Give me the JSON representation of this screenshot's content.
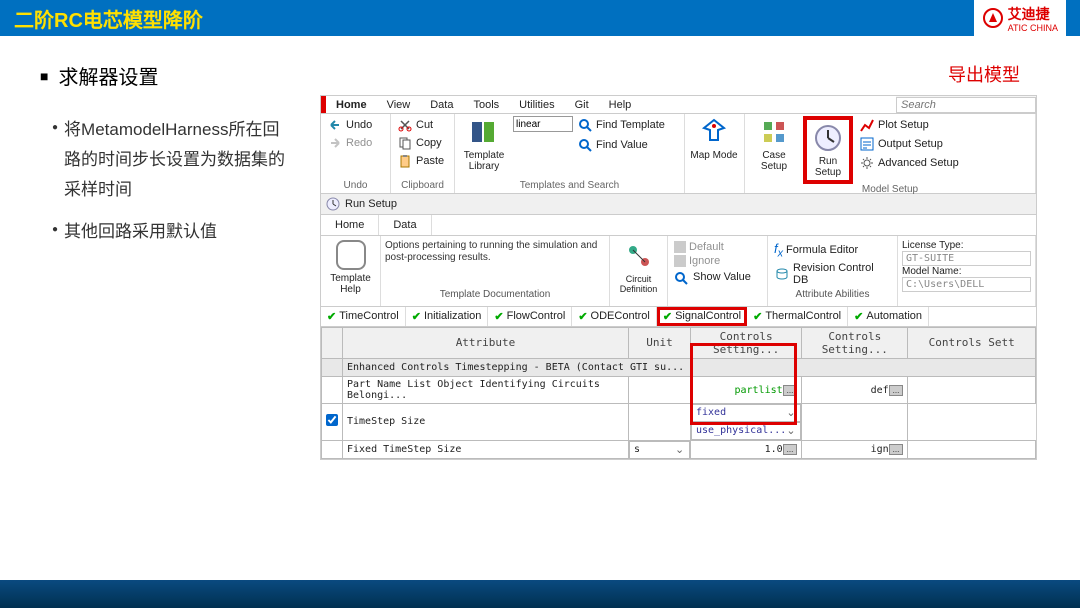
{
  "header": {
    "title": "二阶RC电芯模型降阶",
    "logo1": "艾迪捷",
    "logo2": "ATIC CHINA"
  },
  "left": {
    "section": "求解器设置",
    "export": "导出模型",
    "bullets": [
      "将MetamodelHarness所在回路的时间步长设置为数据集的采样时间",
      "其他回路采用默认值"
    ]
  },
  "ribbon": {
    "tabs": [
      "Home",
      "View",
      "Data",
      "Tools",
      "Utilities",
      "Git",
      "Help"
    ],
    "search": "Search",
    "undo": "Undo",
    "redo": "Redo",
    "g_undo": "Undo",
    "cut": "Cut",
    "copy": "Copy",
    "paste": "Paste",
    "g_clip": "Clipboard",
    "tpl_lib": "Template Library",
    "linear": "linear",
    "find_tpl": "Find Template",
    "find_val": "Find Value",
    "g_tpl": "Templates and Search",
    "map": "Map Mode",
    "case": "Case Setup",
    "run": "Run Setup",
    "plot": "Plot Setup",
    "out": "Output Setup",
    "adv": "Advanced Setup",
    "g_model": "Model Setup"
  },
  "sub": {
    "title": "Run Setup"
  },
  "tabs2": {
    "home": "Home",
    "data": "Data"
  },
  "band": {
    "help": "Template Help",
    "opts": "Options pertaining to running the simulation and post-processing results.",
    "td": "Template Documentation",
    "circ": "Circuit Definition",
    "def": "Default",
    "ign": "Ignore",
    "show": "Show Value",
    "fe": "Formula Editor",
    "rev": "Revision Control DB",
    "aa": "Attribute Abilities",
    "lic": "License Type:",
    "licv": "GT-SUITE",
    "mn": "Model Name:",
    "mnv": "C:\\Users\\DELL"
  },
  "ctabs": [
    "TimeControl",
    "Initialization",
    "FlowControl",
    "ODEControl",
    "SignalControl",
    "ThermalControl",
    "Automation"
  ],
  "grid": {
    "h1": "Attribute",
    "h2": "Unit",
    "h3": "Controls Setting...",
    "h4": "Controls Setting...",
    "h5": "Controls Sett",
    "sec": "Enhanced Controls Timestepping - BETA (Contact GTI su...",
    "r1": "Part Name List Object Identifying Circuits Belongi...",
    "r1v": "partlist",
    "r1v2": "def",
    "r2": "TimeStep Size",
    "r2v": "fixed",
    "r2v2": "use_physical...",
    "r3": "Fixed TimeStep Size",
    "r3u": "s",
    "r3v": "1.0",
    "r3v2": "ign"
  }
}
